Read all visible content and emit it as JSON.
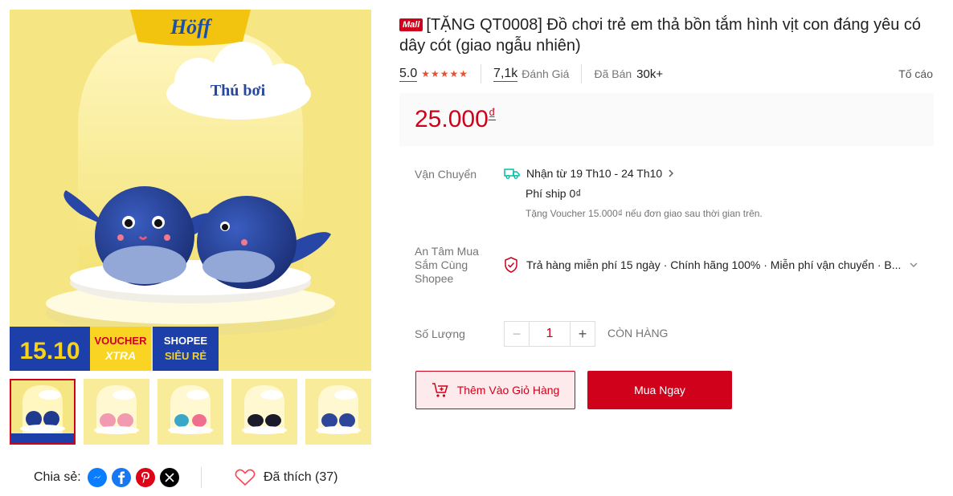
{
  "product": {
    "mall_badge": "Mall",
    "title": "[TẶNG QT0008] Đồ chơi trẻ em thả bồn tắm hình vịt con đáng yêu có dây cót (giao ngẫu nhiên)",
    "rating": "5.0",
    "stars": "★★★★★",
    "reviews_count": "7,1k",
    "reviews_label": "Đánh Giá",
    "sold_label": "Đã Bán",
    "sold_count": "30k+",
    "report_label": "Tố cáo",
    "price": "25.000",
    "currency": "₫"
  },
  "image": {
    "brand": "Höff",
    "cloud_text": "Thú bơi",
    "promo_date": "15.10",
    "voucher_top": "VOUCHER",
    "voucher_bottom": "XTRA",
    "shopee_top": "SHOPEE",
    "shopee_bottom": "SIÊU RẺ"
  },
  "shipping": {
    "label": "Vận Chuyển",
    "delivery": "Nhận từ 19 Th10 - 24 Th10",
    "fee": "Phí ship 0₫",
    "note": "Tặng Voucher 15.000₫ nếu đơn giao sau thời gian trên."
  },
  "assurance": {
    "label_line1": "An Tâm Mua",
    "label_line2": "Sắm Cùng",
    "label_line3": "Shopee",
    "text": "Trả hàng miễn phí 15 ngày · Chính hãng 100% · Miễn phí vận chuyển · B..."
  },
  "quantity": {
    "label": "Số Lượng",
    "value": "1",
    "minus": "−",
    "plus": "+",
    "stock": "CÒN HÀNG"
  },
  "actions": {
    "add_to_cart": "Thêm Vào Giỏ Hàng",
    "buy_now": "Mua Ngay"
  },
  "social": {
    "share_label": "Chia sẻ:",
    "like_label": "Đã thích (37)"
  },
  "colors": {
    "accent": "#d0011b",
    "rating_star": "#ee4d2d",
    "image_bg": "#f7e98a"
  }
}
